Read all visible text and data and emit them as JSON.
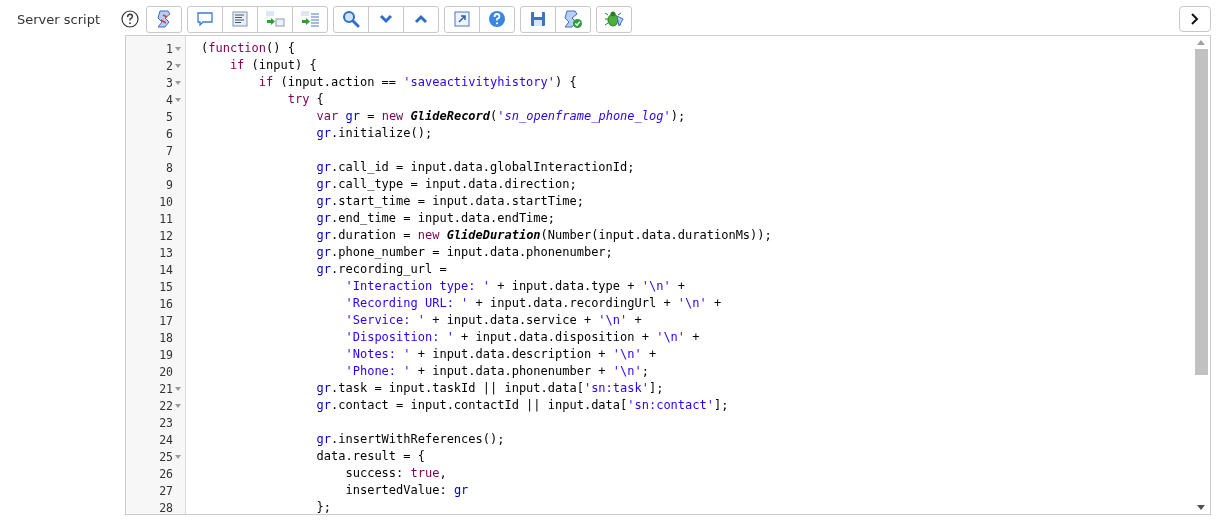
{
  "field": {
    "label": "Server script"
  },
  "toolbar": {
    "groups": [
      [
        {
          "kind": "script"
        }
      ],
      [
        {
          "kind": "comment"
        },
        {
          "kind": "format"
        },
        {
          "kind": "replace"
        },
        {
          "kind": "replace-all"
        }
      ],
      [
        {
          "kind": "search"
        },
        {
          "kind": "next"
        },
        {
          "kind": "previous"
        }
      ],
      [
        {
          "kind": "fullscreen"
        },
        {
          "kind": "help"
        }
      ],
      [
        {
          "kind": "save"
        },
        {
          "kind": "check"
        }
      ],
      [
        {
          "kind": "debug"
        }
      ]
    ]
  },
  "editor": {
    "lines": [
      {
        "n": "1",
        "fold": true,
        "tokens": [
          {
            "kind": "plain",
            "text": "("
          },
          {
            "kind": "kw",
            "text": "function"
          },
          {
            "kind": "plain",
            "text": "() {"
          }
        ]
      },
      {
        "n": "2",
        "fold": true,
        "tokens": [
          {
            "kind": "kw",
            "text": "    if"
          },
          {
            "kind": "plain",
            "text": " (input) {"
          }
        ]
      },
      {
        "n": "3",
        "fold": true,
        "tokens": [
          {
            "kind": "kw",
            "text": "        if"
          },
          {
            "kind": "plain",
            "text": " (input.action == "
          },
          {
            "kind": "str",
            "text": "'saveactivityhistory'"
          },
          {
            "kind": "plain",
            "text": ") {"
          }
        ]
      },
      {
        "n": "4",
        "fold": true,
        "tokens": [
          {
            "kind": "kw",
            "text": "            try"
          },
          {
            "kind": "plain",
            "text": " {"
          }
        ]
      },
      {
        "n": "5",
        "fold": false,
        "tokens": [
          {
            "kind": "kw",
            "text": "                var"
          },
          {
            "kind": "var",
            "text": " gr"
          },
          {
            "kind": "plain",
            "text": " = "
          },
          {
            "kind": "kw",
            "text": "new "
          },
          {
            "kind": "cls",
            "text": "GlideRecord"
          },
          {
            "kind": "plain",
            "text": "("
          },
          {
            "kind": "istr",
            "text": "'sn_openframe_phone_log'"
          },
          {
            "kind": "plain",
            "text": ");"
          }
        ]
      },
      {
        "n": "6",
        "fold": false,
        "tokens": [
          {
            "kind": "var",
            "text": "                gr"
          },
          {
            "kind": "plain",
            "text": ".initialize();"
          }
        ]
      },
      {
        "n": "7",
        "fold": false
      },
      {
        "n": "8",
        "fold": false,
        "tokens": [
          {
            "kind": "var",
            "text": "                gr"
          },
          {
            "kind": "plain",
            "text": ".call_id = input.data.globalInteractionId;"
          }
        ]
      },
      {
        "n": "9",
        "fold": false,
        "tokens": [
          {
            "kind": "var",
            "text": "                gr"
          },
          {
            "kind": "plain",
            "text": ".call_type = input.data.direction;"
          }
        ]
      },
      {
        "n": "10",
        "fold": false,
        "tokens": [
          {
            "kind": "var",
            "text": "                gr"
          },
          {
            "kind": "plain",
            "text": ".start_time = input.data.startTime;"
          }
        ]
      },
      {
        "n": "11",
        "fold": false,
        "tokens": [
          {
            "kind": "var",
            "text": "                gr"
          },
          {
            "kind": "plain",
            "text": ".end_time = input.data.endTime;"
          }
        ]
      },
      {
        "n": "12",
        "fold": false,
        "tokens": [
          {
            "kind": "var",
            "text": "                gr"
          },
          {
            "kind": "plain",
            "text": ".duration = "
          },
          {
            "kind": "kw",
            "text": "new "
          },
          {
            "kind": "cls",
            "text": "GlideDuration"
          },
          {
            "kind": "plain",
            "text": "(Number(input.data.durationMs));"
          }
        ]
      },
      {
        "n": "13",
        "fold": false,
        "tokens": [
          {
            "kind": "var",
            "text": "                gr"
          },
          {
            "kind": "plain",
            "text": ".phone_number = input.data.phonenumber;"
          }
        ]
      },
      {
        "n": "14",
        "fold": false,
        "tokens": [
          {
            "kind": "var",
            "text": "                gr"
          },
          {
            "kind": "plain",
            "text": ".recording_url ="
          }
        ]
      },
      {
        "n": "15",
        "fold": false,
        "tokens": [
          {
            "kind": "str",
            "text": "                    'Interaction type: '"
          },
          {
            "kind": "plain",
            "text": " + input.data.type + "
          },
          {
            "kind": "str",
            "text": "'\\n'"
          },
          {
            "kind": "plain",
            "text": " +"
          }
        ]
      },
      {
        "n": "16",
        "fold": false,
        "tokens": [
          {
            "kind": "str",
            "text": "                    'Recording URL: '"
          },
          {
            "kind": "plain",
            "text": " + input.data.recordingUrl + "
          },
          {
            "kind": "str",
            "text": "'\\n'"
          },
          {
            "kind": "plain",
            "text": " +"
          }
        ]
      },
      {
        "n": "17",
        "fold": false,
        "tokens": [
          {
            "kind": "str",
            "text": "                    'Service: '"
          },
          {
            "kind": "plain",
            "text": " + input.data.service + "
          },
          {
            "kind": "str",
            "text": "'\\n'"
          },
          {
            "kind": "plain",
            "text": " +"
          }
        ]
      },
      {
        "n": "18",
        "fold": false,
        "tokens": [
          {
            "kind": "str",
            "text": "                    'Disposition: '"
          },
          {
            "kind": "plain",
            "text": " + input.data.disposition + "
          },
          {
            "kind": "str",
            "text": "'\\n'"
          },
          {
            "kind": "plain",
            "text": " +"
          }
        ]
      },
      {
        "n": "19",
        "fold": false,
        "tokens": [
          {
            "kind": "str",
            "text": "                    'Notes: '"
          },
          {
            "kind": "plain",
            "text": " + input.data.description + "
          },
          {
            "kind": "str",
            "text": "'\\n'"
          },
          {
            "kind": "plain",
            "text": " +"
          }
        ]
      },
      {
        "n": "20",
        "fold": false,
        "tokens": [
          {
            "kind": "str",
            "text": "                    'Phone: '"
          },
          {
            "kind": "plain",
            "text": " + input.data.phonenumber + "
          },
          {
            "kind": "str",
            "text": "'\\n'"
          },
          {
            "kind": "plain",
            "text": ";"
          }
        ]
      },
      {
        "n": "21",
        "fold": true,
        "tokens": [
          {
            "kind": "var",
            "text": "                gr"
          },
          {
            "kind": "plain",
            "text": ".task = input.taskId || input.data["
          },
          {
            "kind": "str",
            "text": "'sn:task'"
          },
          {
            "kind": "plain",
            "text": "];"
          }
        ]
      },
      {
        "n": "22",
        "fold": true,
        "tokens": [
          {
            "kind": "var",
            "text": "                gr"
          },
          {
            "kind": "plain",
            "text": ".contact = input.contactId || input.data["
          },
          {
            "kind": "str",
            "text": "'sn:contact'"
          },
          {
            "kind": "plain",
            "text": "];"
          }
        ]
      },
      {
        "n": "23",
        "fold": false
      },
      {
        "n": "24",
        "fold": false,
        "tokens": [
          {
            "kind": "var",
            "text": "                gr"
          },
          {
            "kind": "plain",
            "text": ".insertWithReferences();"
          }
        ]
      },
      {
        "n": "25",
        "fold": true,
        "tokens": [
          {
            "kind": "plain",
            "text": "                data.result = {"
          }
        ]
      },
      {
        "n": "26",
        "fold": false,
        "tokens": [
          {
            "kind": "plain",
            "text": "                    success: "
          },
          {
            "kind": "kw",
            "text": "true"
          },
          {
            "kind": "plain",
            "text": ","
          }
        ]
      },
      {
        "n": "27",
        "fold": false,
        "tokens": [
          {
            "kind": "plain",
            "text": "                    insertedValue: "
          },
          {
            "kind": "var",
            "text": "gr"
          }
        ]
      },
      {
        "n": "28",
        "fold": false,
        "tokens": [
          {
            "kind": "plain",
            "text": "                };"
          }
        ]
      }
    ]
  }
}
